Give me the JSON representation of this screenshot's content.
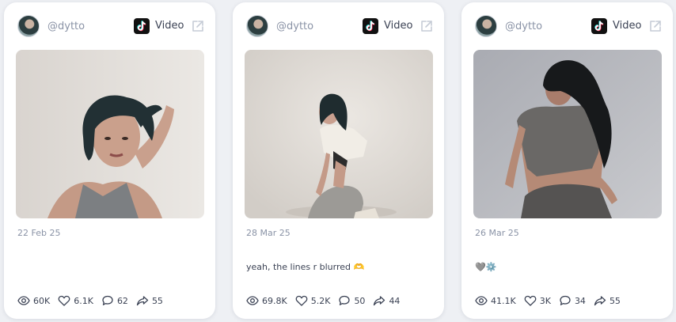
{
  "colors": {
    "page_background": "#eef0f4",
    "card_background": "#ffffff",
    "muted_text": "#8a93a6",
    "primary_text": "#3b4254"
  },
  "posts": [
    {
      "handle": "@dytto",
      "platform_label": "Video",
      "platform_icon": "tiktok-icon",
      "date": "22 Feb 25",
      "caption": "",
      "stats": {
        "views": "60K",
        "likes": "6.1K",
        "comments": "62",
        "shares": "55"
      }
    },
    {
      "handle": "@dytto",
      "platform_label": "Video",
      "platform_icon": "tiktok-icon",
      "date": "28 Mar 25",
      "caption": "yeah, the lines r blurred 🫶",
      "stats": {
        "views": "69.8K",
        "likes": "5.2K",
        "comments": "50",
        "shares": "44"
      }
    },
    {
      "handle": "@dytto",
      "platform_label": "Video",
      "platform_icon": "tiktok-icon",
      "date": "26 Mar 25",
      "caption": "🩶⚙️",
      "stats": {
        "views": "41.1K",
        "likes": "3K",
        "comments": "34",
        "shares": "55"
      }
    }
  ]
}
